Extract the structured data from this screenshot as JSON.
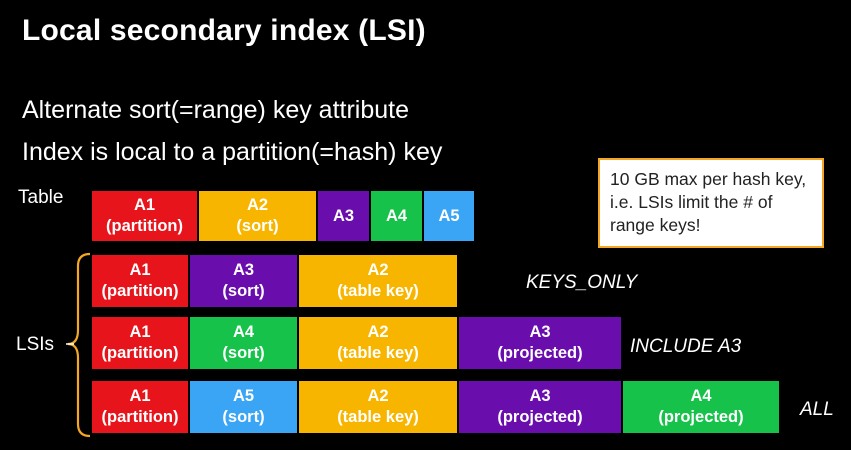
{
  "title": "Local secondary index (LSI)",
  "bullets": [
    "Alternate sort(=range) key attribute",
    "Index is local to a partition(=hash) key"
  ],
  "note": "10 GB max per hash key, i.e. LSIs limit the # of range keys!",
  "labels": {
    "table": "Table",
    "lsis": "LSIs"
  },
  "colors": {
    "red": "#e8141b",
    "amber": "#f7b500",
    "purple": "#6a0dad",
    "green": "#16c24a",
    "blue": "#3aa5f5"
  },
  "table_row": [
    {
      "name": "A1",
      "sub": "(partition)",
      "color": "red"
    },
    {
      "name": "A2",
      "sub": "(sort)",
      "color": "amber"
    },
    {
      "name": "A3",
      "sub": "",
      "color": "purple"
    },
    {
      "name": "A4",
      "sub": "",
      "color": "green"
    },
    {
      "name": "A5",
      "sub": "",
      "color": "blue"
    }
  ],
  "lsi_rows": [
    {
      "projection": "KEYS_ONLY",
      "cells": [
        {
          "name": "A1",
          "sub": "(partition)",
          "color": "red"
        },
        {
          "name": "A3",
          "sub": "(sort)",
          "color": "purple"
        },
        {
          "name": "A2",
          "sub": "(table key)",
          "color": "amber"
        }
      ]
    },
    {
      "projection": "INCLUDE A3",
      "cells": [
        {
          "name": "A1",
          "sub": "(partition)",
          "color": "red"
        },
        {
          "name": "A4",
          "sub": "(sort)",
          "color": "green"
        },
        {
          "name": "A2",
          "sub": "(table key)",
          "color": "amber"
        },
        {
          "name": "A3",
          "sub": "(projected)",
          "color": "purple"
        }
      ]
    },
    {
      "projection": "ALL",
      "cells": [
        {
          "name": "A1",
          "sub": "(partition)",
          "color": "red"
        },
        {
          "name": "A5",
          "sub": "(sort)",
          "color": "blue"
        },
        {
          "name": "A2",
          "sub": "(table key)",
          "color": "amber"
        },
        {
          "name": "A3",
          "sub": "(projected)",
          "color": "purple"
        },
        {
          "name": "A4",
          "sub": "(projected)",
          "color": "green"
        }
      ]
    }
  ]
}
